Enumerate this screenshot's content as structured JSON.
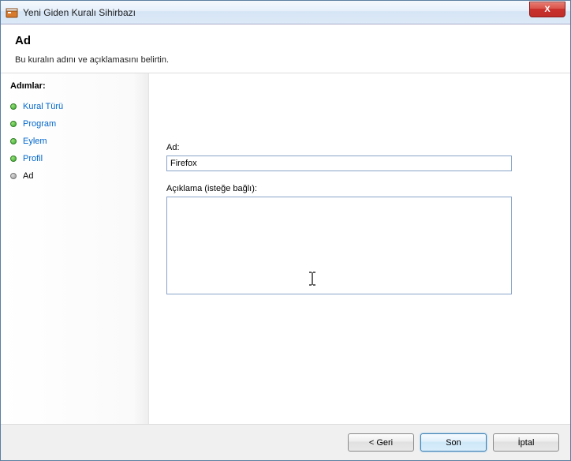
{
  "window": {
    "title": "Yeni Giden Kuralı Sihirbazı",
    "close_glyph": "X"
  },
  "header": {
    "title": "Ad",
    "subtitle": "Bu kuralın adını ve açıklamasını belirtin."
  },
  "sidebar": {
    "steps_label": "Adımlar:",
    "steps": [
      {
        "label": "Kural Türü",
        "state": "done"
      },
      {
        "label": "Program",
        "state": "done"
      },
      {
        "label": "Eylem",
        "state": "done"
      },
      {
        "label": "Profil",
        "state": "done"
      },
      {
        "label": "Ad",
        "state": "current"
      }
    ]
  },
  "form": {
    "name_label": "Ad:",
    "name_value": "Firefox",
    "desc_label": "Açıklama (isteğe bağlı):",
    "desc_value": ""
  },
  "footer": {
    "back": "< Geri",
    "finish": "Son",
    "cancel": "İptal"
  }
}
